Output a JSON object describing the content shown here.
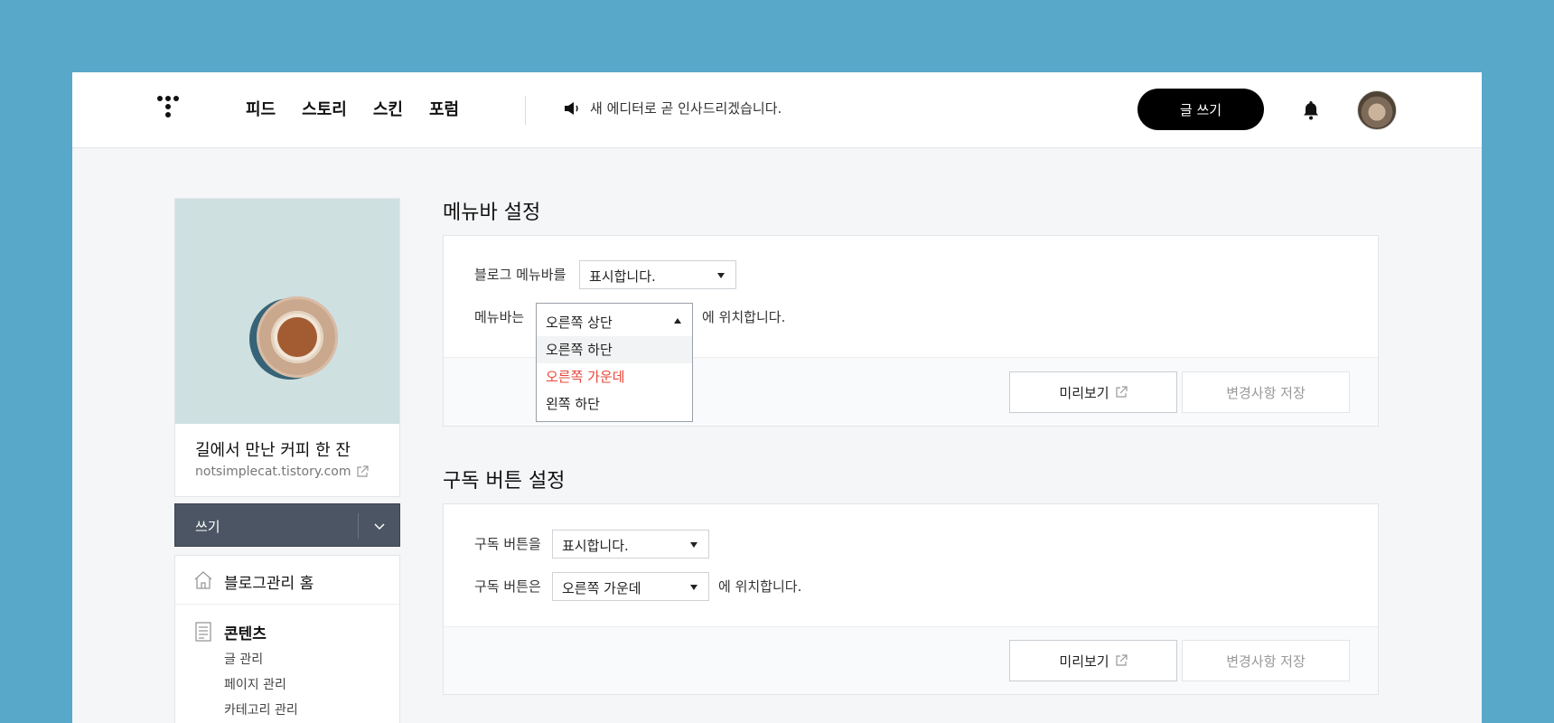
{
  "header": {
    "nav": [
      "피드",
      "스토리",
      "스킨",
      "포럼"
    ],
    "notice": "새 에디터로 곧 인사드리겠습니다.",
    "write_button": "글 쓰기"
  },
  "sidebar": {
    "blog_title": "길에서 만난 커피 한 잔",
    "blog_url": "notsimplecat.tistory.com",
    "write_label": "쓰기",
    "home_label": "블로그관리 홈",
    "content_label": "콘텐츠",
    "content_items": [
      "글 관리",
      "페이지 관리",
      "카테고리 관리"
    ]
  },
  "menubar": {
    "title": "메뉴바 설정",
    "row1_label": "블로그 메뉴바를",
    "row1_value": "표시합니다.",
    "row2_label": "메뉴바는",
    "row2_value": "오른쪽 상단",
    "row2_suffix": "에 위치합니다.",
    "options": [
      "오른쪽 하단",
      "오른쪽 가운데",
      "왼쪽 하단"
    ],
    "option_highlight_color": "#e8483a",
    "preview": "미리보기",
    "save": "변경사항 저장"
  },
  "subscribe": {
    "title": "구독 버튼 설정",
    "row1_label": "구독 버튼을",
    "row1_value": "표시합니다.",
    "row2_label": "구독 버튼은",
    "row2_value": "오른쪽 가운데",
    "row2_suffix": "에 위치합니다.",
    "preview": "미리보기",
    "save": "변경사항 저장"
  }
}
